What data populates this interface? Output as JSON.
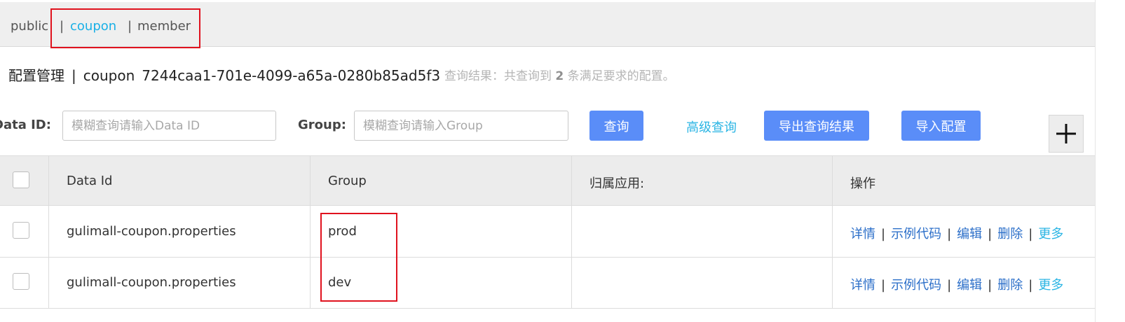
{
  "namespaces": {
    "items": [
      {
        "label": "public",
        "active": false
      },
      {
        "label": "coupon",
        "active": true
      },
      {
        "label": "member",
        "active": false
      }
    ],
    "separator": "|"
  },
  "header": {
    "title": "配置管理",
    "separator": "|",
    "namespace": "coupon",
    "namespace_id": "7244caa1-701e-4099-a65a-0280b85ad5f3",
    "result_prefix": "查询结果：共查询到",
    "result_count": "2",
    "result_suffix": "条满足要求的配置。"
  },
  "search": {
    "data_id_label": "Data ID:",
    "data_id_placeholder": "模糊查询请输入Data ID",
    "group_label": "Group:",
    "group_placeholder": "模糊查询请输入Group",
    "query_button": "查询",
    "advanced_link": "高级查询",
    "export_button": "导出查询结果",
    "import_button": "导入配置",
    "add_button": "+"
  },
  "table": {
    "columns": [
      "Data Id",
      "Group",
      "归属应用:",
      "操作"
    ],
    "rows": [
      {
        "data_id": "gulimall-coupon.properties",
        "group": "prod",
        "app": ""
      },
      {
        "data_id": "gulimall-coupon.properties",
        "group": "dev",
        "app": ""
      }
    ],
    "actions": [
      "详情",
      "示例代码",
      "编辑",
      "删除",
      "更多"
    ],
    "action_separator": "|"
  },
  "colors": {
    "primary_button": "#5a8df8",
    "link": "#2c6fc9",
    "active_namespace": "#1ab0e6",
    "annotation": "#e0121e"
  }
}
